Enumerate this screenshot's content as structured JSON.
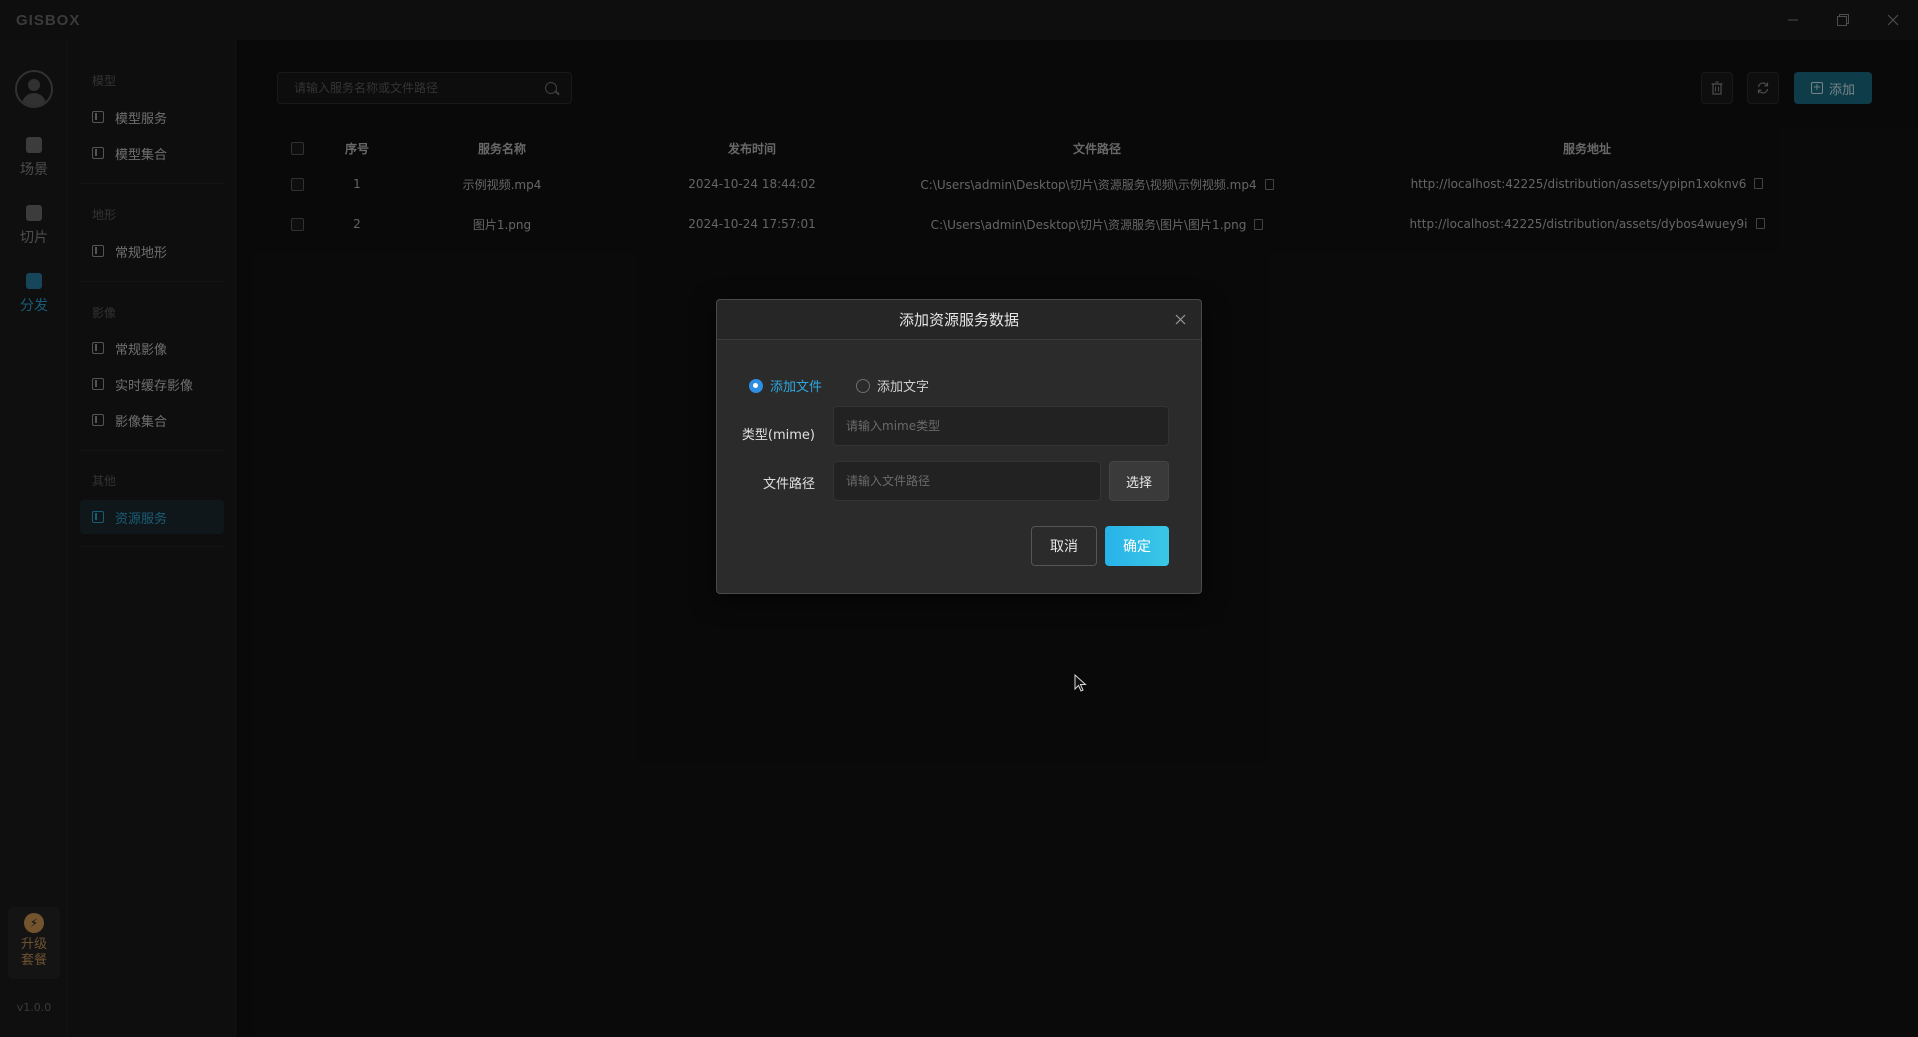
{
  "titlebar": {
    "logo": "GISBOX"
  },
  "rail": {
    "items": [
      {
        "label": "场景",
        "icon": "home-icon"
      },
      {
        "label": "切片",
        "icon": "slice-icon"
      },
      {
        "label": "分发",
        "icon": "distribute-icon"
      }
    ],
    "upgrade_line1": "升级",
    "upgrade_line2": "套餐",
    "version": "v1.0.0"
  },
  "sidemenu": {
    "groups": [
      {
        "title": "模型",
        "items": [
          "模型服务",
          "模型集合"
        ]
      },
      {
        "title": "地形",
        "items": [
          "常规地形"
        ]
      },
      {
        "title": "影像",
        "items": [
          "常规影像",
          "实时缓存影像",
          "影像集合"
        ]
      },
      {
        "title": "其他",
        "items": [
          "资源服务"
        ]
      }
    ]
  },
  "toolbar": {
    "search_placeholder": "请输入服务名称或文件路径",
    "delete_icon": "trash-icon",
    "refresh_icon": "refresh-icon",
    "add_label": "添加"
  },
  "table": {
    "headers": [
      "序号",
      "服务名称",
      "发布时间",
      "文件路径",
      "服务地址"
    ],
    "rows": [
      {
        "index": "1",
        "name": "示例视频.mp4",
        "time": "2024-10-24 18:44:02",
        "path": "C:\\Users\\admin\\Desktop\\切片\\资源服务\\视频\\示例视频.mp4",
        "url": "http://localhost:42225/distribution/assets/ypipn1xoknv6"
      },
      {
        "index": "2",
        "name": "图片1.png",
        "time": "2024-10-24 17:57:01",
        "path": "C:\\Users\\admin\\Desktop\\切片\\资源服务\\图片\\图片1.png",
        "url": "http://localhost:42225/distribution/assets/dybos4wuey9i"
      }
    ]
  },
  "dialog": {
    "title": "添加资源服务数据",
    "radio_file": "添加文件",
    "radio_text": "添加文字",
    "mime_label": "类型(mime)",
    "mime_placeholder": "请输入mime类型",
    "path_label": "文件路径",
    "path_placeholder": "请输入文件路径",
    "pick_label": "选择",
    "cancel_label": "取消",
    "ok_label": "确定"
  },
  "colors": {
    "accent": "#2ea7d8",
    "ok_button": "#27b3e8",
    "add_button": "#1b6f86",
    "upgrade": "#d49a55"
  }
}
